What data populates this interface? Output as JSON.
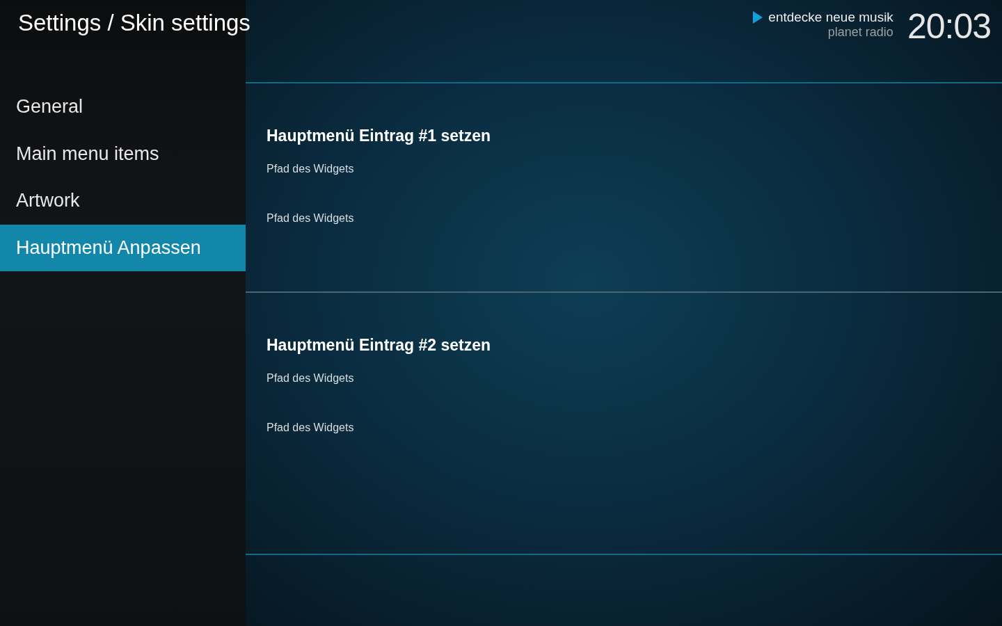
{
  "header": {
    "title": "Settings / Skin settings"
  },
  "now_playing": {
    "title": "entdecke neue musik",
    "subtitle": "planet radio"
  },
  "clock": "20:03",
  "sidebar": {
    "items": [
      {
        "label": "General",
        "selected": false
      },
      {
        "label": "Main menu items",
        "selected": false
      },
      {
        "label": "Artwork",
        "selected": false
      },
      {
        "label": "Hauptmenü Anpassen",
        "selected": true
      }
    ]
  },
  "groups": [
    {
      "heading": "Hauptmenü Eintrag #1 setzen",
      "items": [
        "Pfad des Widgets",
        "Pfad des Widgets"
      ]
    },
    {
      "heading": "Hauptmenü Eintrag #2 setzen",
      "items": [
        "Pfad des Widgets",
        "Pfad des Widgets"
      ]
    }
  ]
}
